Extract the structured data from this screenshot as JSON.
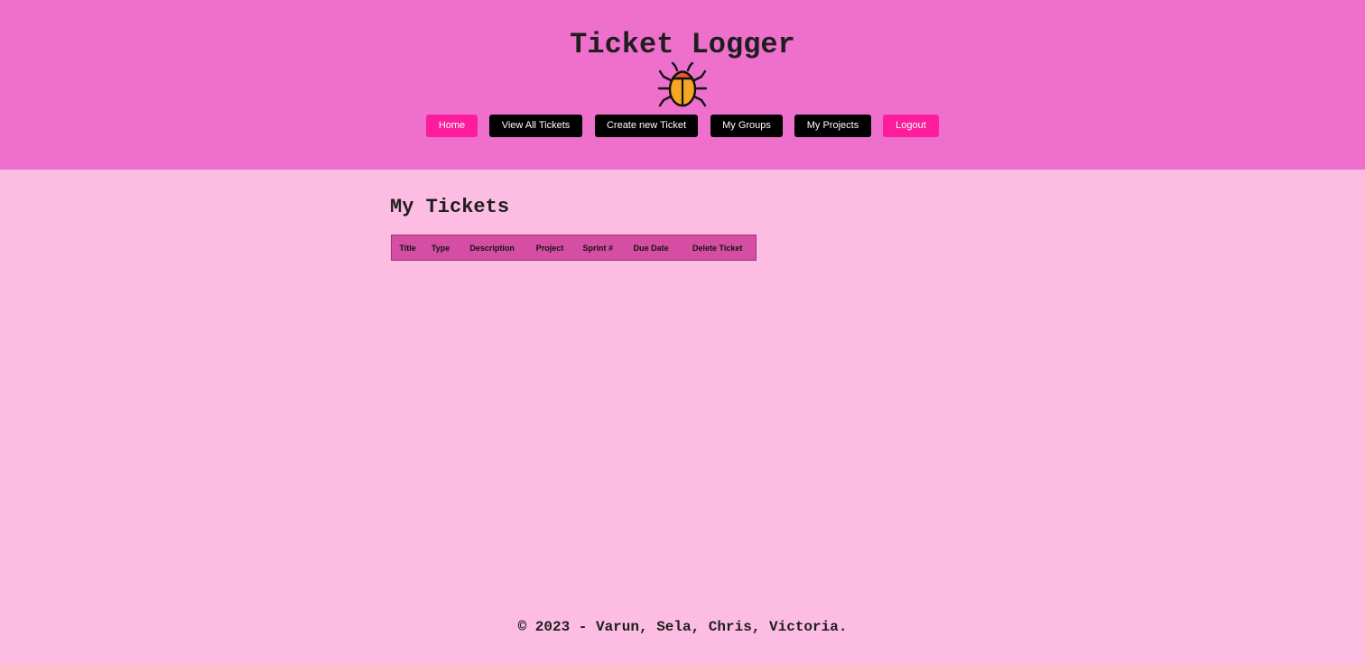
{
  "header": {
    "title": "Ticket Logger",
    "logo_icon": "bug-icon",
    "background": "#ef6fcd"
  },
  "nav": {
    "items": [
      {
        "label": "Home",
        "style": "pink"
      },
      {
        "label": "View All Tickets",
        "style": "dark"
      },
      {
        "label": "Create new Ticket",
        "style": "dark"
      },
      {
        "label": "My Groups",
        "style": "dark"
      },
      {
        "label": "My Projects",
        "style": "dark"
      },
      {
        "label": "Logout",
        "style": "pink"
      }
    ]
  },
  "main": {
    "heading": "My Tickets",
    "table": {
      "columns": [
        "Title",
        "Type",
        "Description",
        "Project",
        "Sprint #",
        "Due Date",
        "Delete Ticket"
      ],
      "rows": []
    }
  },
  "footer": {
    "text": "© 2023 - Varun, Sela, Chris, Victoria."
  },
  "colors": {
    "page_background": "#fdbde3",
    "accent_pink": "#fc1c9c",
    "dark_button": "#000000",
    "table_header": "#d54ea3"
  }
}
